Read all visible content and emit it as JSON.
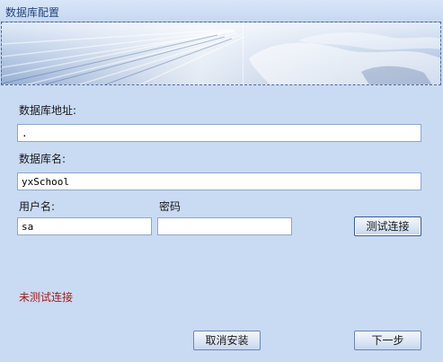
{
  "window": {
    "title": "数据库配置"
  },
  "form": {
    "db_address": {
      "label": "数据库地址:",
      "value": "."
    },
    "db_name": {
      "label": "数据库名:",
      "value": "yxSchool"
    },
    "username": {
      "label": "用户名:",
      "value": "sa"
    },
    "password": {
      "label": "密码",
      "value": ""
    }
  },
  "buttons": {
    "test_connection": "测试连接",
    "cancel_install": "取消安装",
    "next": "下一步"
  },
  "status": {
    "text": "未测试连接",
    "color": "#a11d1d"
  },
  "colors": {
    "panel": "#c9daf3",
    "title_text": "#24467c"
  }
}
